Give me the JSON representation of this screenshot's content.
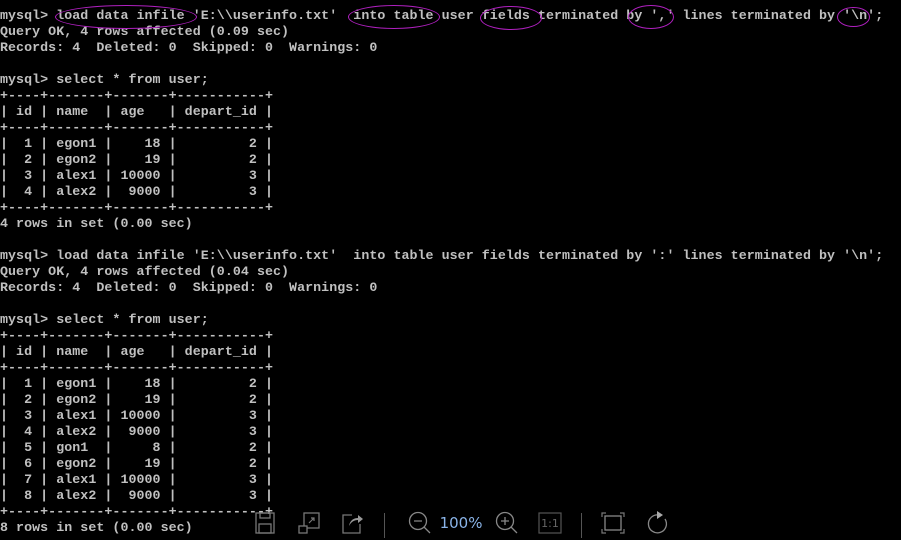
{
  "console": {
    "lines": [
      "mysql> load data infile 'E:\\\\userinfo.txt'  into table user fields terminated by ',' lines terminated by '\\n';",
      "Query OK, 4 rows affected (0.09 sec)",
      "Records: 4  Deleted: 0  Skipped: 0  Warnings: 0",
      "",
      "mysql> select * from user;",
      "+----+-------+-------+-----------+",
      "| id | name  | age   | depart_id |",
      "+----+-------+-------+-----------+",
      "|  1 | egon1 |    18 |         2 |",
      "|  2 | egon2 |    19 |         2 |",
      "|  3 | alex1 | 10000 |         3 |",
      "|  4 | alex2 |  9000 |         3 |",
      "+----+-------+-------+-----------+",
      "4 rows in set (0.00 sec)",
      "",
      "mysql> load data infile 'E:\\\\userinfo.txt'  into table user fields terminated by ':' lines terminated by '\\n';",
      "Query OK, 4 rows affected (0.04 sec)",
      "Records: 4  Deleted: 0  Skipped: 0  Warnings: 0",
      "",
      "mysql> select * from user;",
      "+----+-------+-------+-----------+",
      "| id | name  | age   | depart_id |",
      "+----+-------+-------+-----------+",
      "|  1 | egon1 |    18 |         2 |",
      "|  2 | egon2 |    19 |         2 |",
      "|  3 | alex1 | 10000 |         3 |",
      "|  4 | alex2 |  9000 |         3 |",
      "|  5 | gon1  |     8 |         2 |",
      "|  6 | egon2 |    19 |         2 |",
      "|  7 | alex1 | 10000 |         3 |",
      "|  8 | alex2 |  9000 |         3 |",
      "+----+-------+-------+-----------+",
      "8 rows in set (0.00 sec)"
    ]
  },
  "annotations": {
    "color": "#b020c0",
    "highlighted_terms": [
      "load data infile",
      "into table",
      "fields",
      "by ','",
      "'\\n'"
    ]
  },
  "toolbar": {
    "zoom_level": "100%",
    "actual_size_label": "1:1",
    "icons": [
      "save-icon",
      "resize-icon",
      "share-icon",
      "zoom-out-icon",
      "zoom-in-icon",
      "actual-size-icon",
      "fullscreen-icon",
      "rotate-icon"
    ]
  }
}
